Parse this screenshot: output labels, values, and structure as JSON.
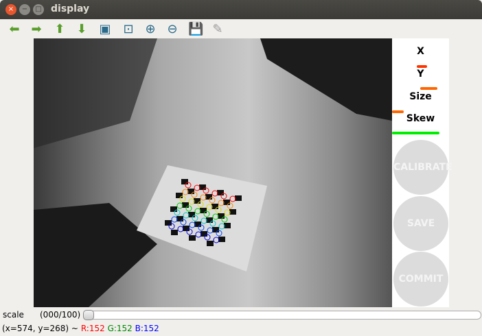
{
  "window": {
    "title": "display",
    "close": "×",
    "minimize": "−",
    "maximize": "□"
  },
  "toolbar": [
    {
      "name": "pan-left-icon",
      "glyph": "⬅"
    },
    {
      "name": "pan-right-icon",
      "glyph": "➡"
    },
    {
      "name": "pan-up-icon",
      "glyph": "⬆"
    },
    {
      "name": "pan-down-icon",
      "glyph": "⬇"
    },
    {
      "name": "zoom-reset-icon",
      "glyph": "▣"
    },
    {
      "name": "zoom-fit-icon",
      "glyph": "⊡"
    },
    {
      "name": "zoom-in-icon",
      "glyph": "⊕"
    },
    {
      "name": "zoom-out-icon",
      "glyph": "⊖"
    },
    {
      "name": "save-icon",
      "glyph": "💾"
    },
    {
      "name": "properties-icon",
      "glyph": "✎"
    }
  ],
  "panel": {
    "labels": {
      "x": "X",
      "y": "Y",
      "size": "Size",
      "skew": "Skew"
    },
    "progress": {
      "size": [
        0.0,
        0.2
      ],
      "skew": [
        0.0,
        0.83
      ]
    },
    "colors": {
      "x": "#ff3300",
      "y": "#ff6600",
      "size": "#ff6600",
      "skew": "#00ee00"
    },
    "buttons": {
      "calibrate": "CALIBRATE",
      "save": "SAVE",
      "commit": "COMMIT"
    }
  },
  "scale": {
    "label": "scale",
    "value": "(000/100)",
    "fraction": 0
  },
  "status": {
    "coords": "(x=574, y=268) ~",
    "r": "R:152",
    "g": "G:152",
    "b": "B:152"
  }
}
